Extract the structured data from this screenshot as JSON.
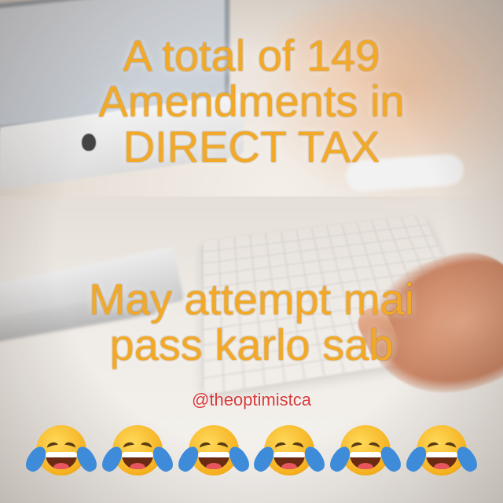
{
  "caption": {
    "line1": "A total of 149",
    "line2": "Amendments in",
    "line3": "DIRECT TAX",
    "line4": "May attempt mai",
    "line5": "pass karlo sab"
  },
  "handle": "@theoptimistca",
  "emoji": {
    "name": "face-with-tears-of-joy",
    "count": 6
  },
  "colors": {
    "caption_text": "#f2a927",
    "handle_text": "#d83a3a",
    "emoji_face": "#f5b01f",
    "emoji_tear": "#3d8bd9"
  }
}
